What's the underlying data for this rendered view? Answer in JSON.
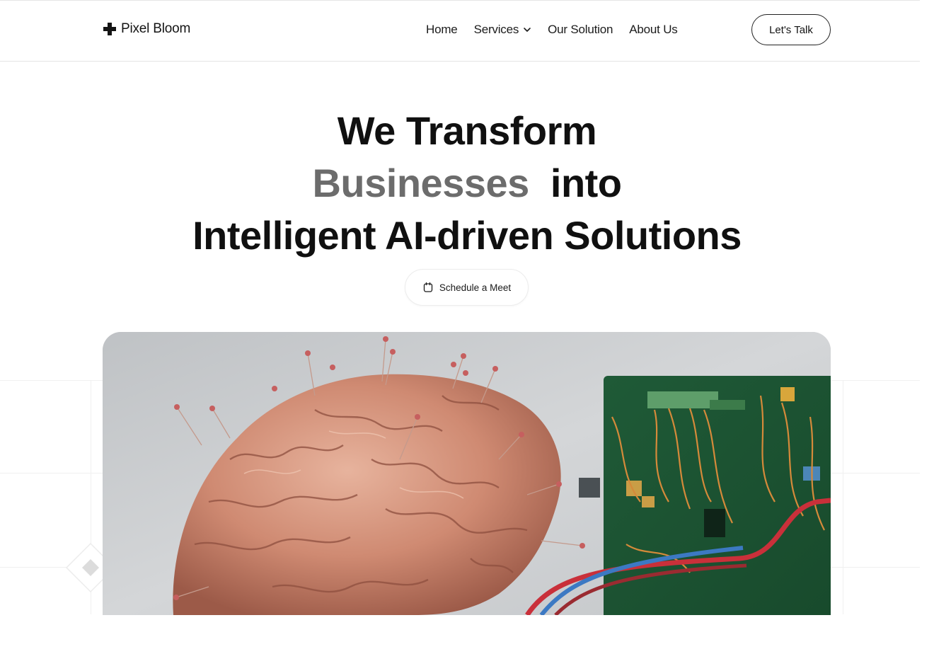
{
  "header": {
    "brand": "Pixel Bloom",
    "nav": [
      {
        "label": "Home"
      },
      {
        "label": "Services",
        "has_dropdown": true
      },
      {
        "label": "Our Solution"
      },
      {
        "label": "About Us"
      }
    ],
    "cta_label": "Let's Talk"
  },
  "hero": {
    "line1": "We Transform",
    "line2_muted": "Businesses",
    "line2_rest": "into",
    "line3": "Intelligent AI-driven Solutions",
    "meet_label": "Schedule a Meet"
  },
  "icons": {
    "logo": "plus-cross-icon",
    "services_dropdown": "chevron-down-icon",
    "meet": "calendar-icon"
  },
  "colors": {
    "text": "#111111",
    "muted": "#6c6c6c",
    "border": "#222222",
    "divider": "#e4e4e4"
  }
}
